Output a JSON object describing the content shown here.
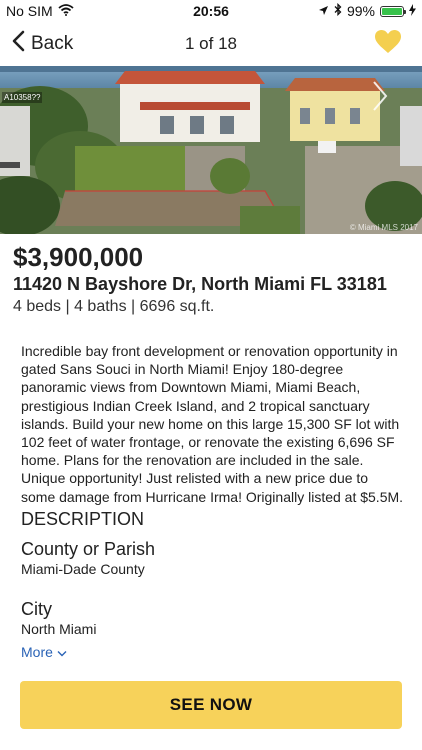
{
  "status_bar": {
    "carrier": "No SIM",
    "time": "20:56",
    "battery": "99%",
    "battery_level": 0.99,
    "icons": [
      "wifi-icon",
      "location-arrow-icon",
      "bluetooth-icon",
      "battery-icon",
      "charging-bolt-icon"
    ]
  },
  "nav": {
    "back_label": "Back",
    "title": "1 of 18",
    "favorite_icon": "heart-icon",
    "accent_color": "#f4cf4f"
  },
  "photo": {
    "id_label": "A10358??",
    "watermark": "© Miami MLS 2017",
    "next_icon": "chevron-right-icon"
  },
  "listing": {
    "price": "$3,900,000",
    "address": "11420 N Bayshore Dr, North Miami FL 33181",
    "specs": "4 beds | 4 baths | 6696 sq.ft.",
    "description": "Incredible bay front development or renovation opportunity in gated Sans Souci in North Miami! Enjoy 180-degree panoramic views from Downtown Miami, Miami Beach, prestigious Indian Creek Island, and 2 tropical sanctuary islands. Build your new home on this large 15,300 SF lot with 102 feet of water frontage, or renovate the existing 6,696 SF home. Plans for the renovation are included in the sale. Unique opportunity! Just relisted with a new price due to some damage from Hurricane Irma! Originally listed at $5.5M."
  },
  "details": {
    "section_title": "DESCRIPTION",
    "fields": [
      {
        "label": "County or Parish",
        "value": "Miami-Dade County"
      },
      {
        "label": "City",
        "value": "North Miami"
      }
    ],
    "more_label": "More",
    "more_color": "#2a63b6"
  },
  "cta": {
    "label": "SEE NOW",
    "color": "#f7d25a"
  }
}
